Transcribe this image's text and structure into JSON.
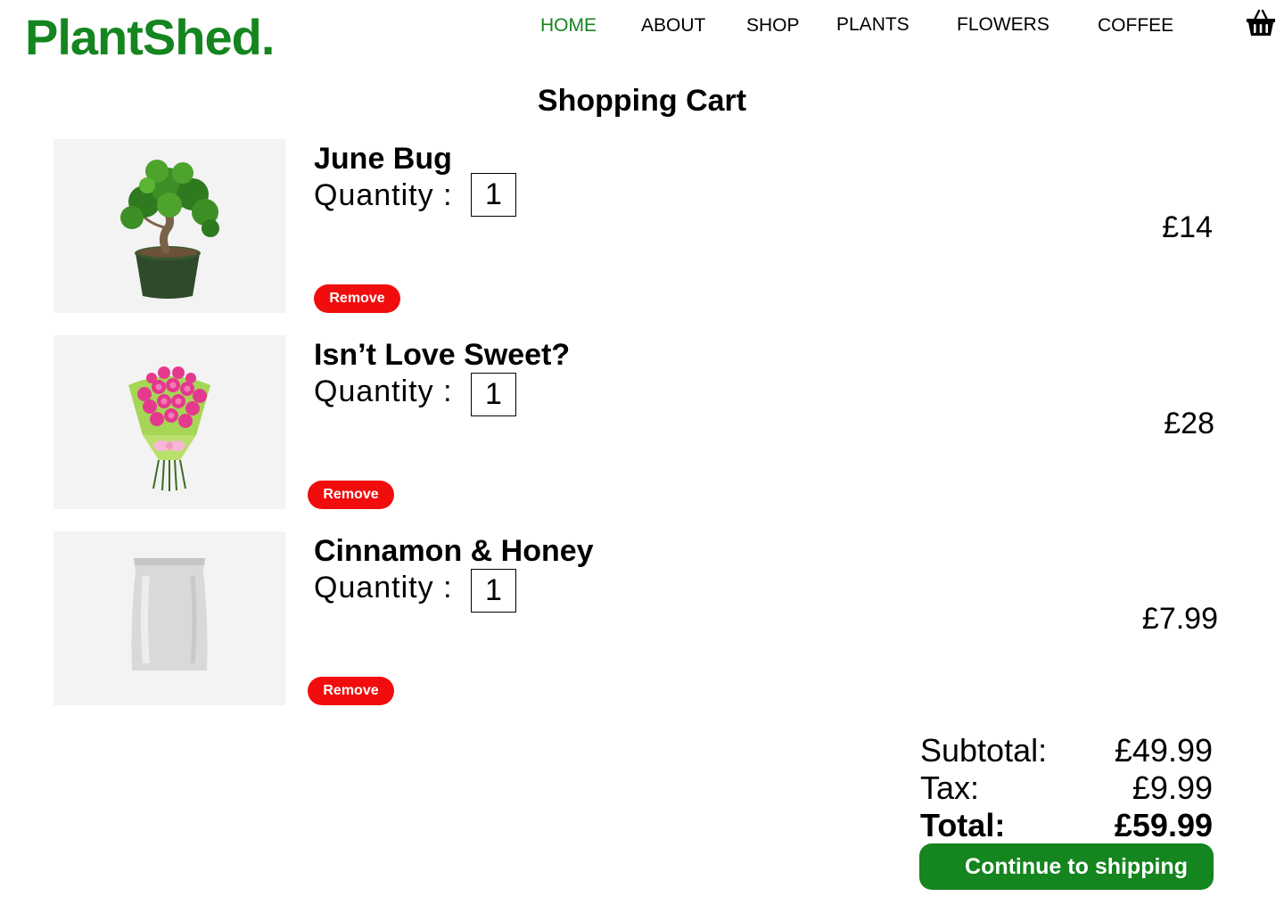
{
  "brand": {
    "logo": "PlantShed.",
    "color": "#14851f"
  },
  "nav": {
    "home": "HOME",
    "about": "ABOUT",
    "shop": "SHOP",
    "plants": "PLANTS",
    "flowers": "FLOWERS",
    "coffee": "COFFEE",
    "active": "HOME",
    "cart_icon": "basket-icon"
  },
  "page": {
    "title": "Shopping Cart"
  },
  "cart": {
    "quantity_label": "Quantity :",
    "remove_label": "Remove",
    "items": [
      {
        "name": "June Bug",
        "quantity": "1",
        "price": "£14",
        "image": "bonsai-tree-image"
      },
      {
        "name": "Isn’t Love Sweet?",
        "quantity": "1",
        "price": "£28",
        "image": "pink-rose-bouquet-image"
      },
      {
        "name": "Cinnamon & Honey",
        "quantity": "1",
        "price": "£7.99",
        "image": "coffee-bag-image"
      }
    ]
  },
  "summary": {
    "subtotal_label": "Subtotal:",
    "subtotal_value": "£49.99",
    "tax_label": "Tax:",
    "tax_value": "£9.99",
    "total_label": "Total:",
    "total_value": "£59.99"
  },
  "actions": {
    "continue_label": "Continue to shipping"
  },
  "colors": {
    "accent": "#14851f",
    "remove": "#f10d0d",
    "thumb_bg": "#f3f3f3"
  }
}
